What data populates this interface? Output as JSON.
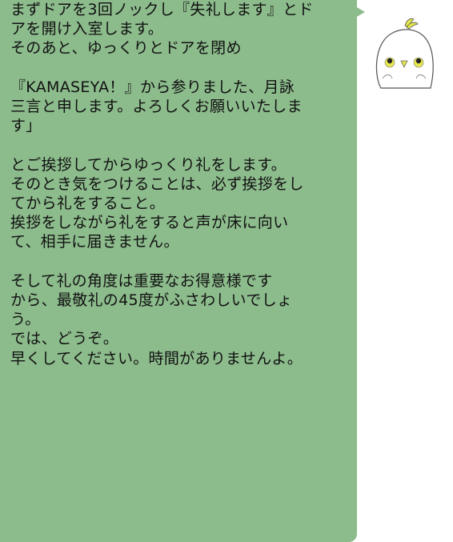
{
  "colors": {
    "bubble": "#8cbb8c",
    "text": "#111111",
    "background": "#ffffff",
    "avatar_crest": "#e3e64a",
    "avatar_eye_ring": "#e8e94f"
  },
  "avatar": {
    "icon": "bird-mascot-icon"
  },
  "message": {
    "lines": [
      "まずドアを3回ノックし『失礼します』とド",
      "アを開け入室します。",
      "そのあと、ゆっくりとドアを閉め",
      "",
      "『KAMASEYA！』から参りました、月詠",
      "三言と申します。よろしくお願いいたしま",
      "す」",
      "",
      "とご挨拶してからゆっくり礼をします。",
      "そのとき気をつけることは、必ず挨拶をし",
      "てから礼をすること。",
      "挨拶をしながら礼をすると声が床に向い",
      "て、相手に届きません。",
      "",
      "そして礼の角度は重要なお得意様です",
      "から、最敬礼の45度がふさわしいでしょ",
      "う。",
      "では、どうぞ。",
      "早くしてください。時間がありませんよ。"
    ]
  }
}
